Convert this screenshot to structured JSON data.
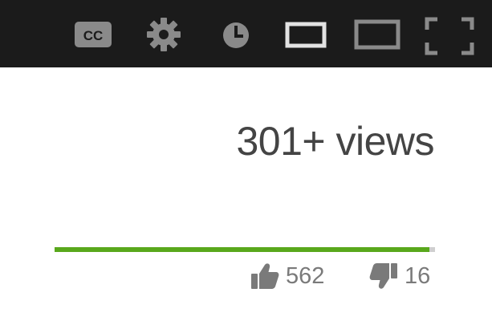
{
  "player_controls": {
    "cc_label": "CC",
    "icons": [
      "cc-icon",
      "gear-icon",
      "clock-icon",
      "small-player-icon",
      "large-player-icon",
      "fullscreen-icon"
    ]
  },
  "stats": {
    "views_label": "301+ views",
    "likes": "562",
    "dislikes": "16",
    "like_ratio": 0.986
  },
  "colors": {
    "bar_background": "#1b1b1b",
    "icon_gray": "#8a8a8a",
    "icon_active": "#e2e2e2",
    "like_green": "#59a81c",
    "dislike_gray": "#cfcfcf"
  }
}
